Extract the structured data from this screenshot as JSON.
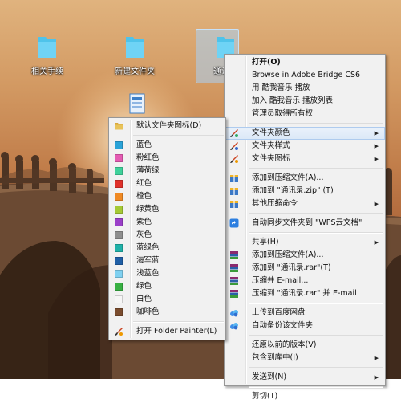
{
  "desktop": {
    "icons": [
      {
        "label": "相关手续"
      },
      {
        "label": "新建文件夹"
      },
      {
        "label": "通讯录"
      }
    ]
  },
  "context_menu": {
    "items": [
      {
        "label": "打开(O)",
        "bold": true
      },
      {
        "label": "Browse in Adobe Bridge CS6"
      },
      {
        "label": "用 酷我音乐 播放"
      },
      {
        "label": "加入 酷我音乐 播放列表"
      },
      {
        "label": "管理员取得所有权"
      },
      {
        "label": "文件夹颜色",
        "icon": "brush-icon",
        "submenu": true
      },
      {
        "label": "文件夹样式",
        "icon": "brush-icon",
        "submenu": true
      },
      {
        "label": "文件夹图标",
        "icon": "brush-icon",
        "submenu": true
      },
      {
        "label": "添加到压缩文件(A)...",
        "icon": "archive-icon"
      },
      {
        "label": "添加到 \"通讯录.zip\" (T)",
        "icon": "archive-icon"
      },
      {
        "label": "其他压缩命令",
        "icon": "archive-icon",
        "submenu": true
      },
      {
        "label": "自动同步文件夹到 \"WPS云文档\"",
        "icon": "cloud-sync-icon"
      },
      {
        "label": "共享(H)",
        "submenu": true
      },
      {
        "label": "添加到压缩文件(A)...",
        "icon": "winrar-icon"
      },
      {
        "label": "添加到 \"通讯录.rar\"(T)",
        "icon": "winrar-icon"
      },
      {
        "label": "压缩并 E-mail...",
        "icon": "winrar-icon"
      },
      {
        "label": "压缩到 \"通讯录.rar\" 并 E-mail",
        "icon": "winrar-icon"
      },
      {
        "label": "上传到百度网盘",
        "icon": "baidu-cloud-icon"
      },
      {
        "label": "自动备份该文件夹",
        "icon": "baidu-cloud-icon"
      },
      {
        "label": "还原以前的版本(V)"
      },
      {
        "label": "包含到库中(I)",
        "submenu": true
      },
      {
        "label": "发送到(N)",
        "submenu": true
      },
      {
        "label": "剪切(T)"
      }
    ]
  },
  "color_submenu": {
    "items": [
      {
        "label": "默认文件夹图标(D)",
        "color": "#e8c35a",
        "icon": "folder-icon"
      },
      {
        "label": "蓝色",
        "color": "#2aa3d8"
      },
      {
        "label": "粉红色",
        "color": "#e45bb3"
      },
      {
        "label": "薄荷绿",
        "color": "#3fd19a"
      },
      {
        "label": "红色",
        "color": "#e0312a"
      },
      {
        "label": "橙色",
        "color": "#f08a24"
      },
      {
        "label": "绿黄色",
        "color": "#a5c934"
      },
      {
        "label": "紫色",
        "color": "#9a3fc8"
      },
      {
        "label": "灰色",
        "color": "#8e8e8e"
      },
      {
        "label": "蓝绿色",
        "color": "#1fb1a8"
      },
      {
        "label": "海军蓝",
        "color": "#1f5fa6"
      },
      {
        "label": "浅蓝色",
        "color": "#7fd0f0"
      },
      {
        "label": "绿色",
        "color": "#38b043"
      },
      {
        "label": "白色",
        "color": "#f6f6f6"
      },
      {
        "label": "咖啡色",
        "color": "#7a4c2e"
      },
      {
        "label": "打开 Folder Painter(L)",
        "icon": "brush-icon"
      }
    ]
  }
}
